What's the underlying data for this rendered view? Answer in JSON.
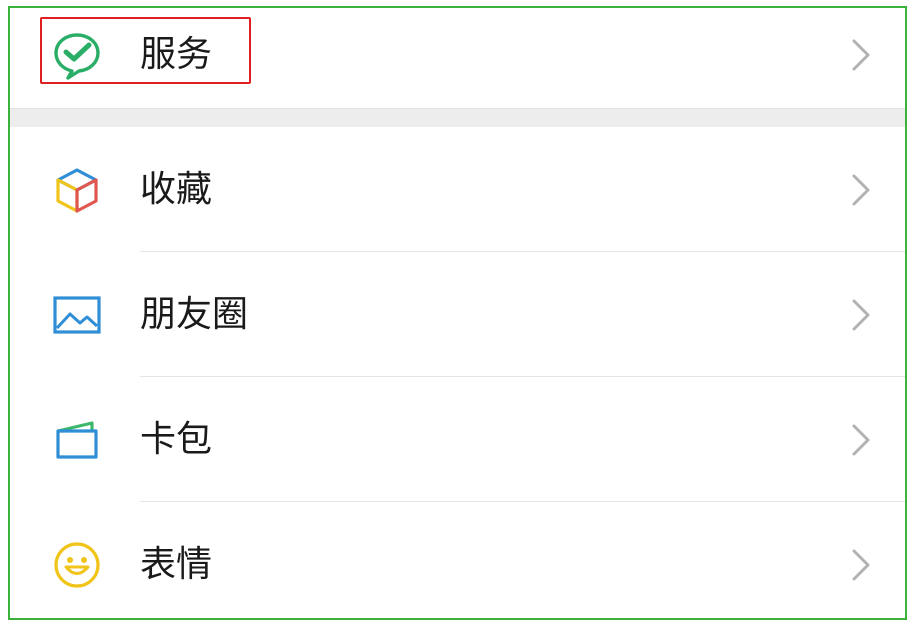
{
  "menu": {
    "items": [
      {
        "id": "services",
        "label": "服务",
        "icon": "wechat-pay-icon"
      },
      {
        "id": "favorites",
        "label": "收藏",
        "icon": "favorites-cube-icon"
      },
      {
        "id": "moments",
        "label": "朋友圈",
        "icon": "moments-picture-icon"
      },
      {
        "id": "cards",
        "label": "卡包",
        "icon": "card-wallet-icon"
      },
      {
        "id": "stickers",
        "label": "表情",
        "icon": "smiley-icon"
      }
    ],
    "chevron_icon": "chevron-right-icon"
  },
  "colors": {
    "frame_border": "#3cb13c",
    "highlight_border": "#e02020",
    "section_gap": "#ededed",
    "divider": "#e6e6e6",
    "chevron": "#b2b2b2",
    "label_text": "#1a1a1a",
    "pay_green": "#2aae67",
    "moments_blue": "#2f8ed6",
    "card_blue": "#2f8ed6",
    "card_green": "#3db86b",
    "smiley_yellow": "#f0c419"
  }
}
